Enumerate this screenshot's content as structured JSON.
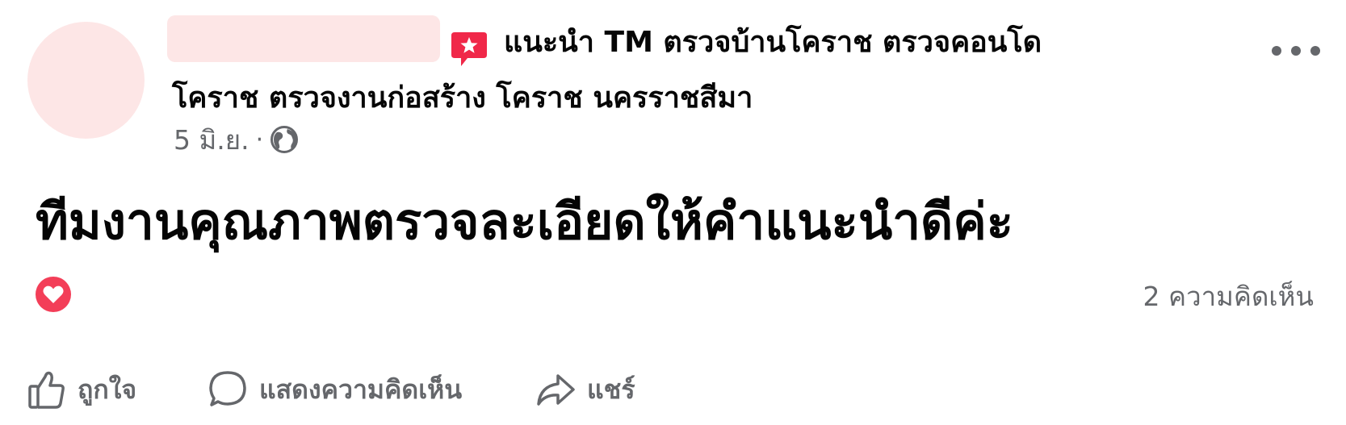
{
  "post": {
    "group_name_line1": "แนะนำ TM ตรวจบ้านโคราช ตรวจคอนโด",
    "group_name_line2": "โคราช ตรวจงานก่อสร้าง โคราช นครราชสีมา",
    "date": "5 มิ.ย.",
    "separator": "·",
    "privacy_icon": "globe-icon",
    "badge_icon": "star-badge-icon",
    "message": "ทีมงานคุณภาพตรวจละเอียดให้คำแนะนำดีค่ะ",
    "reaction_icon": "love-reaction-icon",
    "comment_count_text": "2 ความคิดเห็น"
  },
  "actions": {
    "like_label": "ถูกใจ",
    "comment_label": "แสดงความคิดเห็น",
    "share_label": "แชร์"
  },
  "colors": {
    "text_primary": "#050505",
    "text_secondary": "#65676b",
    "redaction": "#fde6e6",
    "badge": "#f02849",
    "love": "#f33e58"
  }
}
